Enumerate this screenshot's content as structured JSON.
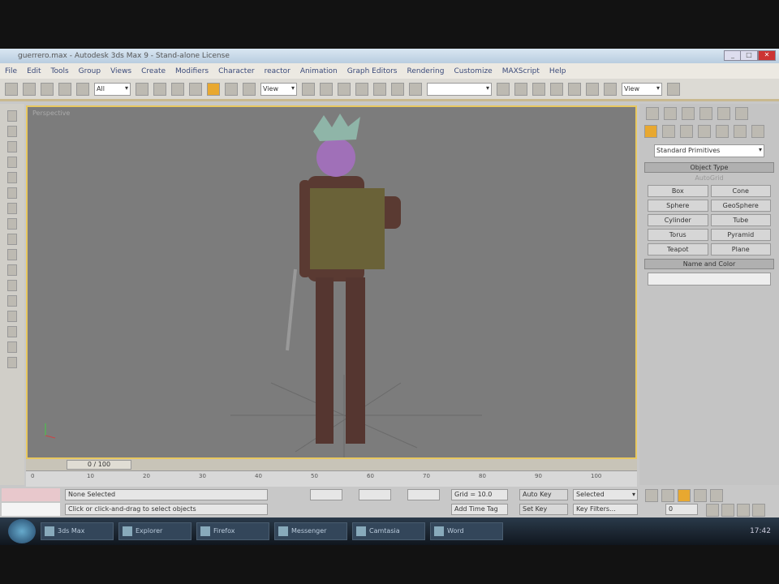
{
  "window": {
    "title": "guerrero.max - Autodesk 3ds Max 9 - Stand-alone License"
  },
  "menu": [
    "File",
    "Edit",
    "Tools",
    "Group",
    "Views",
    "Create",
    "Modifiers",
    "Character",
    "reactor",
    "Animation",
    "Graph Editors",
    "Rendering",
    "Customize",
    "MAXScript",
    "Help"
  ],
  "toolbar": {
    "selection_filter": "All",
    "coord_system": "View",
    "named_selection": "",
    "render_type": "View"
  },
  "viewport": {
    "label": "Perspective"
  },
  "command_panel": {
    "category": "Standard Primitives",
    "object_type_header": "Object Type",
    "autogrid": "AutoGrid",
    "objects": [
      "Box",
      "Cone",
      "Sphere",
      "GeoSphere",
      "Cylinder",
      "Tube",
      "Torus",
      "Pyramid",
      "Teapot",
      "Plane"
    ],
    "name_color_header": "Name and Color"
  },
  "timeline": {
    "slider": "0 / 100",
    "ticks": [
      "0",
      "10",
      "20",
      "30",
      "40",
      "50",
      "60",
      "70",
      "80",
      "90",
      "100"
    ]
  },
  "status": {
    "selection": "None Selected",
    "prompt": "Click or click-and-drag to select objects",
    "grid": "Grid = 10.0",
    "add_time_tag": "Add Time Tag",
    "auto_key": "Auto Key",
    "set_key": "Set Key",
    "key_mode": "Selected",
    "frame": "0",
    "key_filters": "Key Filters..."
  },
  "taskbar": {
    "items": [
      "3ds Max",
      "Explorer",
      "Firefox",
      "Messenger",
      "Camtasia",
      "Word"
    ],
    "clock": "17:42"
  }
}
